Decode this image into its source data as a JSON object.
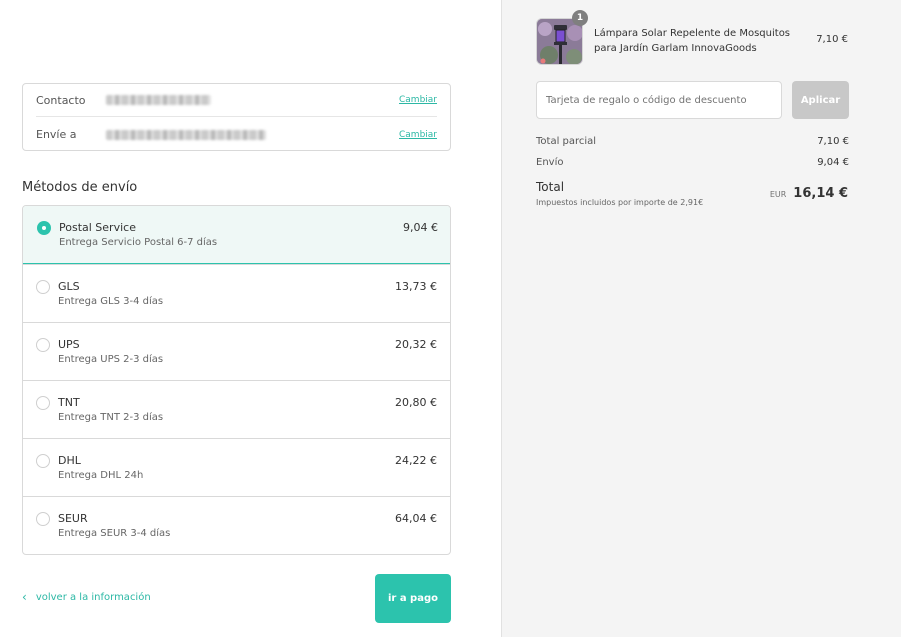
{
  "review": {
    "contact_label": "Contacto",
    "ship_to_label": "Envíe a",
    "change_label": "Cambiar"
  },
  "shipping": {
    "title": "Métodos de envío",
    "methods": [
      {
        "name": "Postal Service",
        "desc": "Entrega Servicio Postal 6-7 días",
        "price": "9,04 €",
        "selected": true
      },
      {
        "name": "GLS",
        "desc": "Entrega GLS 3-4 días",
        "price": "13,73 €",
        "selected": false
      },
      {
        "name": "UPS",
        "desc": "Entrega UPS 2-3 días",
        "price": "20,32 €",
        "selected": false
      },
      {
        "name": "TNT",
        "desc": "Entrega TNT 2-3 días",
        "price": "20,80 €",
        "selected": false
      },
      {
        "name": "DHL",
        "desc": "Entrega DHL 24h",
        "price": "24,22 €",
        "selected": false
      },
      {
        "name": "SEUR",
        "desc": "Entrega SEUR 3-4 días",
        "price": "64,04 €",
        "selected": false
      }
    ]
  },
  "nav": {
    "back_label": "volver a la información",
    "pay_label": "ir a pago"
  },
  "summary": {
    "product_quantity": "1",
    "product_name": "Lámpara Solar Repelente de Mosquitos para Jardín Garlam InnovaGoods",
    "product_price": "7,10 €",
    "discount_placeholder": "Tarjeta de regalo o código de descuento",
    "apply_label": "Aplicar",
    "subtotal_label": "Total parcial",
    "subtotal_value": "7,10 €",
    "shipping_label": "Envío",
    "shipping_value": "9,04 €",
    "total_label": "Total",
    "tax_note": "Impuestos incluidos por importe de 2,91€",
    "currency": "EUR",
    "total_value": "16,14 €"
  },
  "colors": {
    "accent": "#2cc3ad",
    "selected_bg": "#eff8f6",
    "sidebar_bg": "#f4f4f4",
    "apply_disabled": "#c8c8c8"
  }
}
